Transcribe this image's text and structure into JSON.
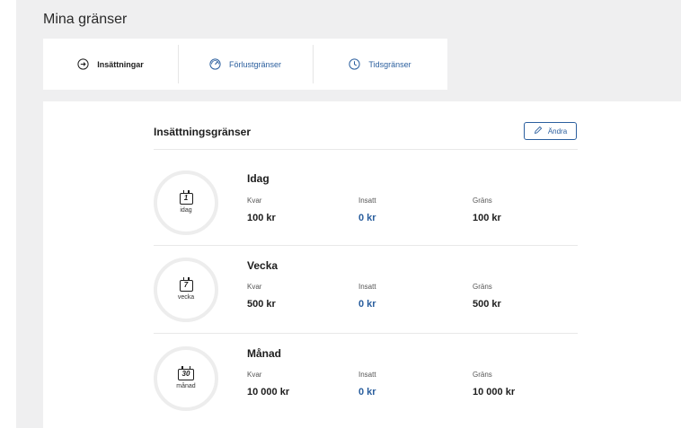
{
  "page": {
    "title": "Mina gränser"
  },
  "tabs": [
    {
      "label": "Insättningar",
      "icon": "arrow-circle-right-icon",
      "active": true
    },
    {
      "label": "Förlustgränser",
      "icon": "gauge-icon",
      "active": false
    },
    {
      "label": "Tidsgränser",
      "icon": "clock-icon",
      "active": false
    }
  ],
  "section": {
    "title": "Insättningsgränser",
    "edit_label": "Ändra"
  },
  "limits": [
    {
      "period": "Idag",
      "calendar_number": "1",
      "ring_label": "idag",
      "remaining_label": "Kvar",
      "remaining": "100 kr",
      "deposited_label": "Insatt",
      "deposited": "0 kr",
      "limit_label": "Gräns",
      "limit": "100 kr"
    },
    {
      "period": "Vecka",
      "calendar_number": "7",
      "ring_label": "vecka",
      "remaining_label": "Kvar",
      "remaining": "500 kr",
      "deposited_label": "Insatt",
      "deposited": "0 kr",
      "limit_label": "Gräns",
      "limit": "500 kr"
    },
    {
      "period": "Månad",
      "calendar_number": "30",
      "ring_label": "månad",
      "remaining_label": "Kvar",
      "remaining": "10 000 kr",
      "deposited_label": "Insatt",
      "deposited": "0 kr",
      "limit_label": "Gräns",
      "limit": "10 000 kr"
    }
  ],
  "colors": {
    "accent": "#2b5f9e",
    "background": "#efeff0"
  }
}
